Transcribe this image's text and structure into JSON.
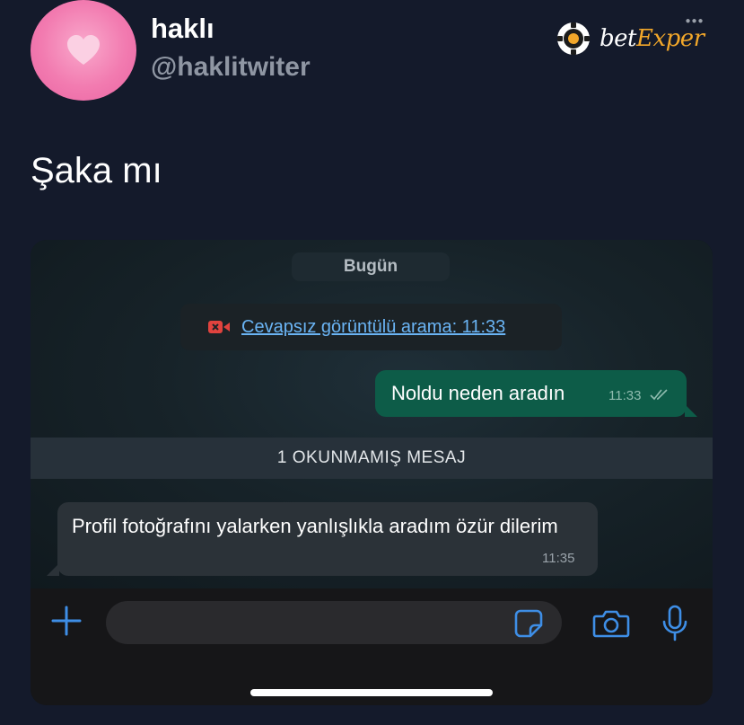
{
  "tweet": {
    "username": "haklı",
    "handle": "@haklitwiter",
    "text": "Şaka mı",
    "avatar_icon": "heart-icon",
    "avatar_color": "#f27bb0"
  },
  "watermark": {
    "logo_part1": "bet",
    "logo_part2": "Exper",
    "accent": "#f2a72a"
  },
  "chat": {
    "date_label": "Bugün",
    "missed_call": {
      "icon": "video-camera-icon",
      "text": "Cevapsız görüntülü arama: 11:33"
    },
    "outgoing": {
      "text": "Noldu neden aradın",
      "time": "11:33",
      "status_icon": "double-check-icon",
      "color": "#0d5c48"
    },
    "unread_divider": "1 OKUNMAMIŞ MESAJ",
    "incoming": {
      "text": "Profil fotoğrafını yalarken yanlışlıkla aradım özür dilerim",
      "time": "11:35",
      "color": "#2b3238"
    }
  },
  "composer": {
    "placeholder": "",
    "accent": "#3e8ee6"
  }
}
